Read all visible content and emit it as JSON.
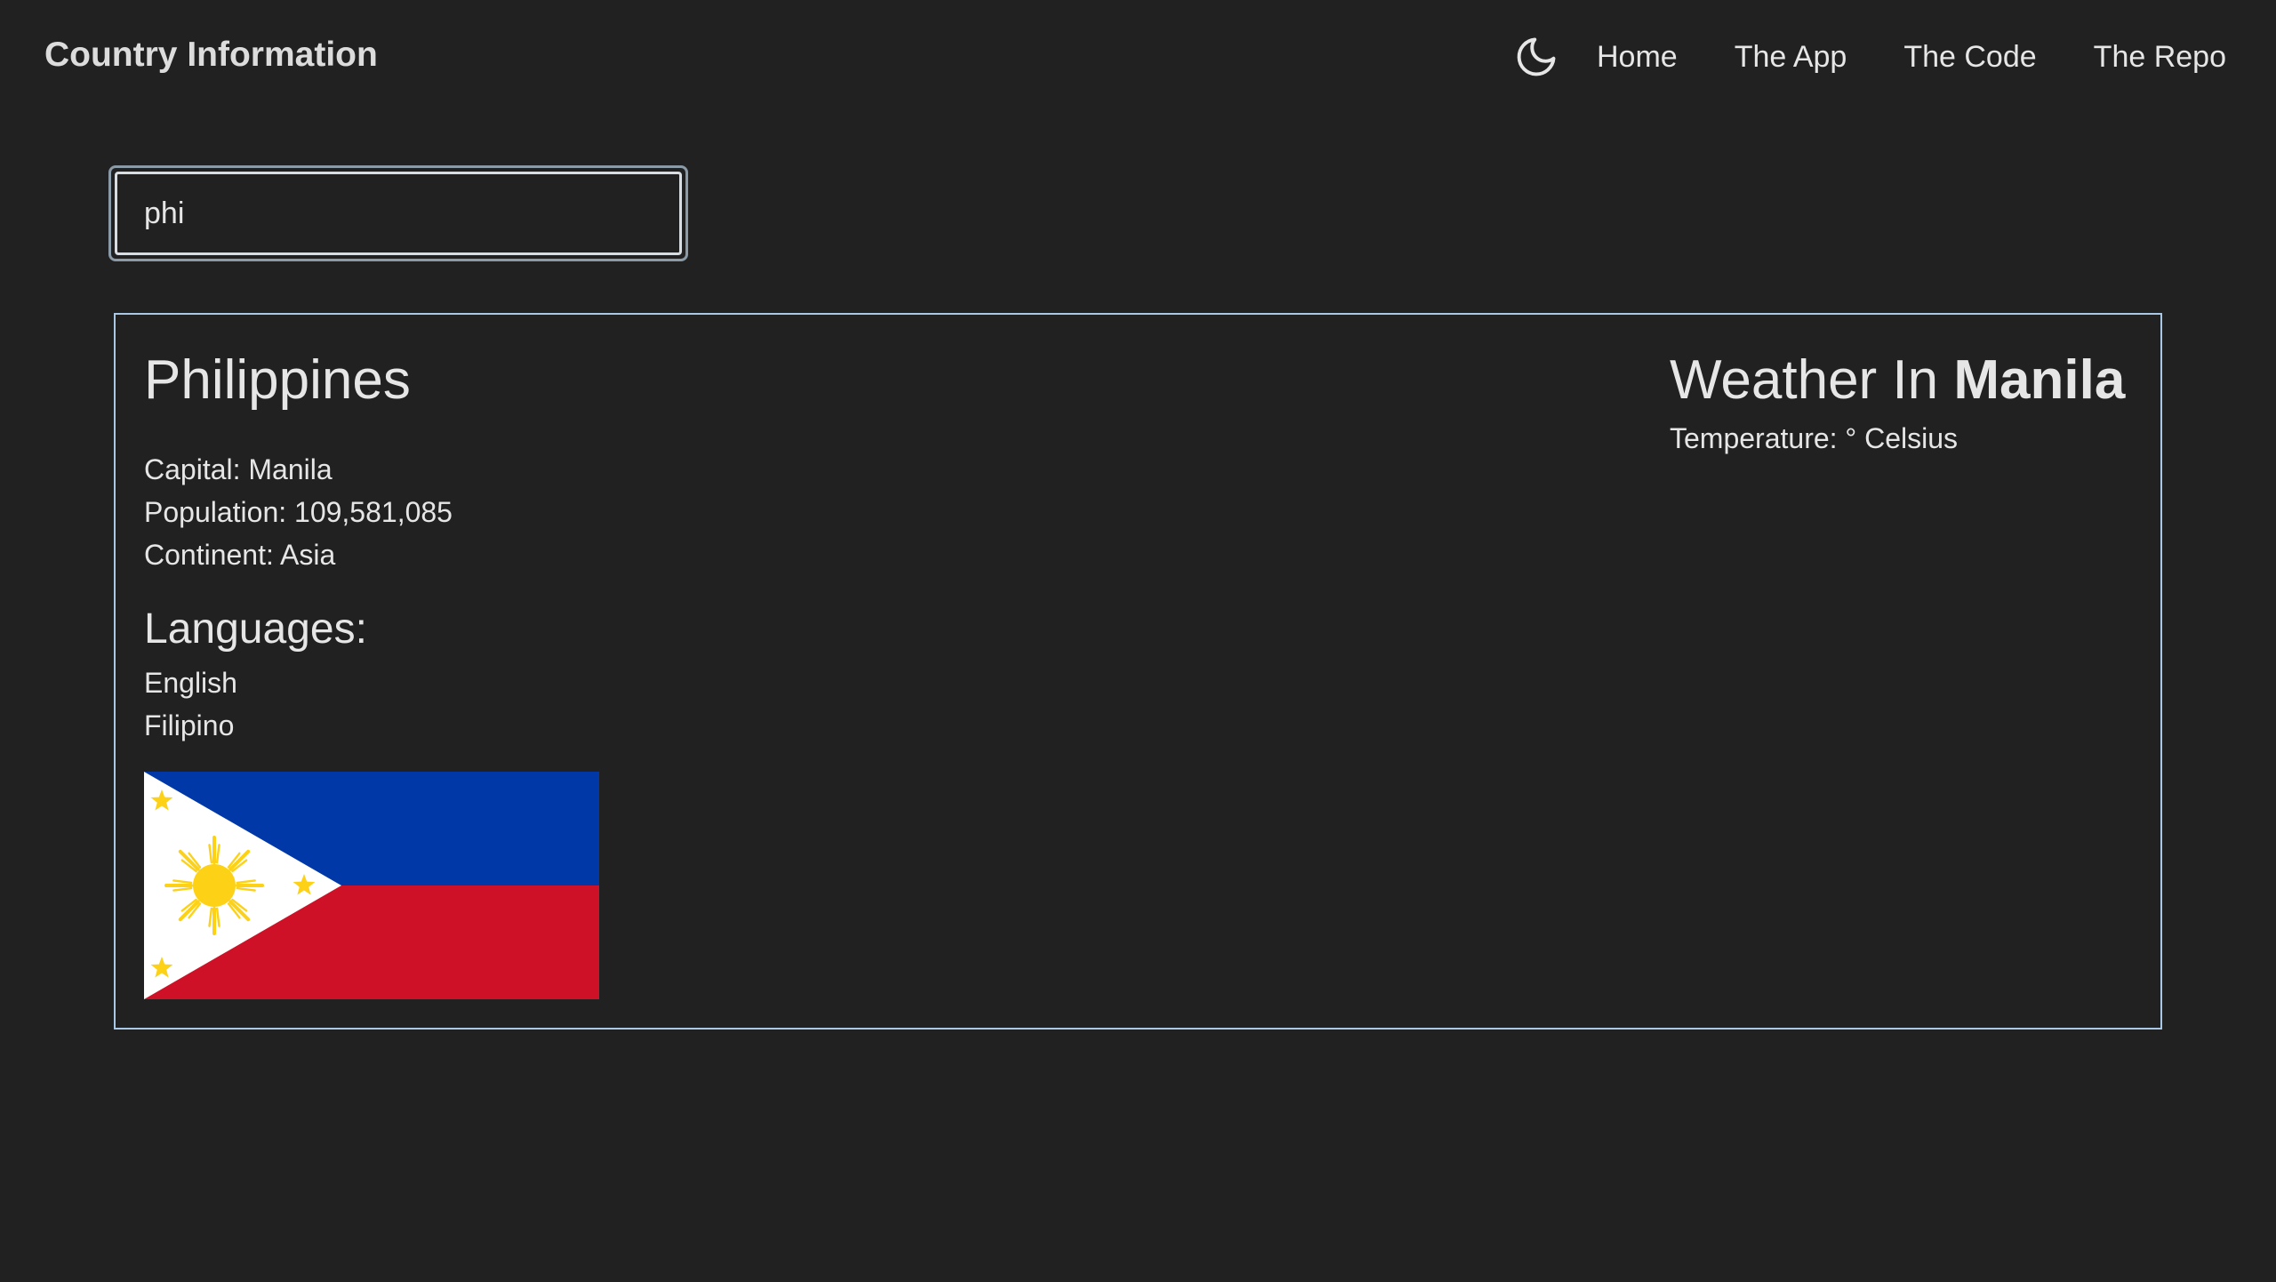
{
  "navbar": {
    "brand": "Country Information",
    "theme_toggle_icon": "moon-icon",
    "links": [
      {
        "label": "Home"
      },
      {
        "label": "The App"
      },
      {
        "label": "The Code"
      },
      {
        "label": "The Repo"
      }
    ]
  },
  "search": {
    "value": "phi",
    "placeholder": ""
  },
  "country": {
    "name": "Philippines",
    "capital_label": "Capital:",
    "capital": "Manila",
    "population_label": "Population:",
    "population": "109,581,085",
    "continent_label": "Continent:",
    "continent": "Asia",
    "languages_heading": "Languages:",
    "languages": [
      "English",
      "Filipino"
    ],
    "flag_icon": "philippines-flag",
    "flag_colors": {
      "blue": "#0038a8",
      "red": "#ce1126",
      "white": "#ffffff",
      "gold": "#fcd116"
    }
  },
  "weather": {
    "prefix": "Weather In",
    "city": "Manila",
    "temperature_label": "Temperature:",
    "temperature_value": "",
    "temperature_unit": "° Celsius"
  },
  "colors": {
    "background": "#212121",
    "text": "#e6e6e6",
    "card_border": "#a9c8e6"
  }
}
